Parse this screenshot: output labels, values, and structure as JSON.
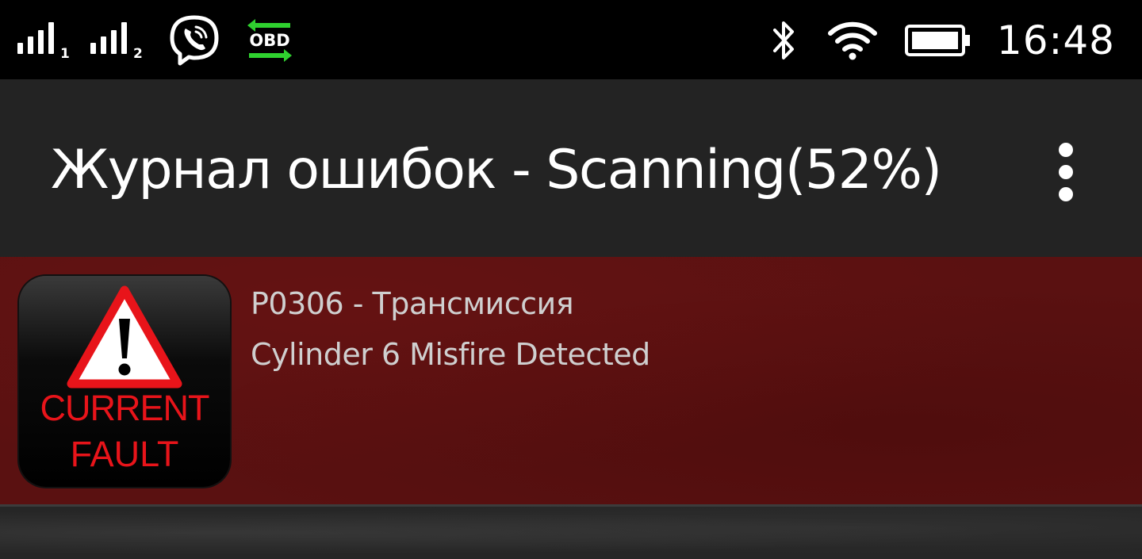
{
  "status_bar": {
    "sim1_label": "1",
    "sim2_label": "2",
    "obd_label": "OBD",
    "time": "16:48",
    "icons": [
      "signal-icon",
      "signal-icon",
      "viber-icon",
      "obd-icon",
      "bluetooth-icon",
      "wifi-icon",
      "battery-icon"
    ],
    "obd_color": "#2fd12f"
  },
  "app_bar": {
    "title": "Журнал ошибок - Scanning(52%)",
    "scan_progress_percent": 52,
    "menu_icon": "more-vertical-icon"
  },
  "faults": [
    {
      "icon": {
        "name": "current-fault-icon",
        "line1": "CURRENT",
        "line2": "FAULT",
        "text_color": "#e8141a"
      },
      "code_line": "P0306 - Трансмиссия",
      "description": "Cylinder 6 Misfire Detected"
    }
  ],
  "colors": {
    "app_bar": "#232323",
    "fault_row": "#5a1111",
    "text": "#cfcfcf"
  }
}
